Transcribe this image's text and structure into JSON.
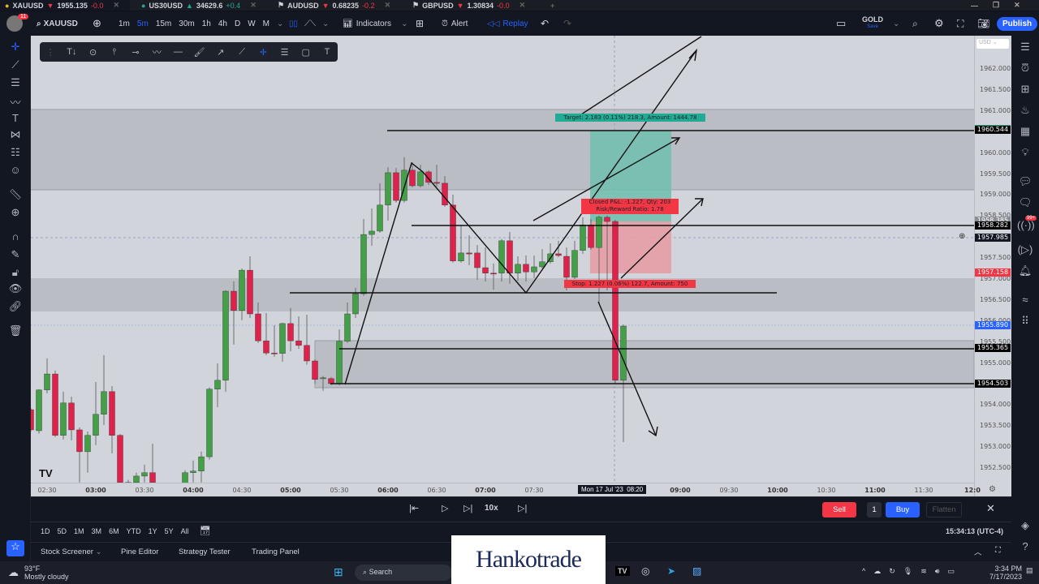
{
  "tabs": [
    {
      "symbol": "XAUUSD",
      "dir": "down",
      "price": "1955.135",
      "change": "-0.0"
    },
    {
      "symbol": "US30USD",
      "dir": "up",
      "price": "34629.6",
      "change": "+0.4"
    },
    {
      "symbol": "AUDUSD",
      "dir": "down",
      "price": "0.68235",
      "change": "-0.2"
    },
    {
      "symbol": "GBPUSD",
      "dir": "down",
      "price": "1.30834",
      "change": "-0.0"
    }
  ],
  "toolbar": {
    "notif_badge": "11",
    "symbol": "XAUUSD",
    "intervals": [
      "1m",
      "5m",
      "15m",
      "30m",
      "1h",
      "4h",
      "D",
      "W",
      "M"
    ],
    "active_interval": "5m",
    "indicators": "Indicators",
    "alert": "Alert",
    "replay": "Replay",
    "layout_name": "GOLD",
    "layout_status": "Save",
    "publish": "Publish"
  },
  "currency_select": "USD",
  "price_axis": {
    "labels": [
      "1962.000",
      "1961.500",
      "1961.000",
      "1960.500",
      "1960.000",
      "1959.500",
      "1959.000",
      "1958.500",
      "1958.000",
      "1957.500",
      "1957.000",
      "1956.500",
      "1956.000",
      "1955.500",
      "1955.000",
      "1954.500",
      "1954.000",
      "1953.500",
      "1953.000",
      "1952.500"
    ],
    "markers": [
      {
        "price": "1960.568",
        "color": "#22ab94"
      },
      {
        "price": "1960.544",
        "color": "#000000"
      },
      {
        "price": "1958.385",
        "color": "#8a8d94"
      },
      {
        "price": "1958.282",
        "color": "#000000"
      },
      {
        "price": "1957.985",
        "color": "#131722"
      },
      {
        "price": "1957.158",
        "color": "#f23645"
      },
      {
        "price": "1955.890",
        "color": "#2962ff"
      },
      {
        "price": "1955.365",
        "color": "#000000"
      },
      {
        "price": "1954.503",
        "color": "#000000"
      }
    ]
  },
  "time_axis": {
    "labels": [
      [
        "02:30",
        0
      ],
      [
        "03:00",
        1
      ],
      [
        "03:30",
        0
      ],
      [
        "04:00",
        1
      ],
      [
        "04:30",
        0
      ],
      [
        "05:00",
        1
      ],
      [
        "05:30",
        0
      ],
      [
        "06:00",
        1
      ],
      [
        "06:30",
        0
      ],
      [
        "07:00",
        1
      ],
      [
        "07:30",
        0
      ],
      [
        "09:00",
        1
      ],
      [
        "09:30",
        0
      ],
      [
        "10:00",
        1
      ],
      [
        "10:30",
        0
      ],
      [
        "11:00",
        1
      ],
      [
        "11:30",
        0
      ],
      [
        "12:0",
        1
      ]
    ],
    "crosshair": "Mon 17 Jul '23",
    "crosshair_time": "08:20"
  },
  "position": {
    "target": "Target: 2.183 (0.11%) 218.3, Amount: 1444.78",
    "closed_pnl": "Closed P&L: -1.227, Qty: 203",
    "rr": "Risk/Reward Ratio: 1.78",
    "stop": "Stop: 1.227 (0.06%) 122.7, Amount: 750"
  },
  "chart_data": {
    "type": "candlestick",
    "symbol": "XAUUSD",
    "interval": "5m",
    "ylim": [
      1952.3,
      1962.5
    ],
    "colors": {
      "up": "#43a047",
      "down": "#e0214b",
      "background": "#d1d4db",
      "zone": "#babdc3"
    },
    "candles_fields": [
      "time",
      "open",
      "high",
      "low",
      "close"
    ],
    "candles": [
      [
        "02:20",
        1953.89,
        1953.93,
        1953.37,
        1953.41
      ],
      [
        "02:25",
        1953.39,
        1954.38,
        1953.32,
        1954.36
      ],
      [
        "02:30",
        1954.36,
        1955.11,
        1954.28,
        1954.74
      ],
      [
        "02:35",
        1954.74,
        1954.82,
        1953.24,
        1953.28
      ],
      [
        "02:40",
        1953.28,
        1954.32,
        1953.18,
        1954.05
      ],
      [
        "02:45",
        1954.05,
        1954.2,
        1953.16,
        1953.41
      ],
      [
        "02:50",
        1953.41,
        1953.47,
        1952.16,
        1952.89
      ],
      [
        "02:55",
        1952.89,
        1953.37,
        1952.39,
        1953.28
      ],
      [
        "03:00",
        1953.28,
        1954.55,
        1953.05,
        1953.78
      ],
      [
        "03:05",
        1953.78,
        1955.19,
        1953.53,
        1954.32
      ],
      [
        "03:10",
        1954.32,
        1954.45,
        1952.85,
        1953.28
      ],
      [
        "03:15",
        1953.28,
        1953.31,
        1952.1,
        1952.16
      ],
      [
        "03:20",
        1952.16,
        1952.22,
        1951.48,
        1951.67
      ],
      [
        "03:25",
        1952.16,
        1952.39,
        1952.06,
        1952.31
      ],
      [
        "03:30",
        1952.31,
        1952.58,
        1952.16,
        1952.39
      ],
      [
        "03:35",
        1952.39,
        1953.08,
        1952.06,
        1952.16
      ],
      [
        "03:40",
        1952.1,
        1952.05,
        1951.7,
        1951.8
      ],
      [
        "03:45",
        1951.8,
        1951.95,
        1951.5,
        1951.6
      ],
      [
        "03:50",
        1951.6,
        1952.0,
        1951.5,
        1951.9
      ],
      [
        "03:55",
        1951.9,
        1952.45,
        1951.85,
        1952.39
      ],
      [
        "04:00",
        1952.39,
        1952.68,
        1952.16,
        1952.43
      ],
      [
        "04:05",
        1952.43,
        1952.89,
        1952.16,
        1952.77
      ],
      [
        "04:10",
        1952.77,
        1954.42,
        1952.7,
        1954.38
      ],
      [
        "04:15",
        1954.38,
        1954.99,
        1953.95,
        1954.59
      ],
      [
        "04:20",
        1954.59,
        1956.73,
        1954.32,
        1956.71
      ],
      [
        "04:25",
        1956.71,
        1956.94,
        1955.44,
        1956.25
      ],
      [
        "04:30",
        1956.25,
        1957.25,
        1956.02,
        1957.21
      ],
      [
        "04:35",
        1957.21,
        1957.54,
        1956.07,
        1956.17
      ],
      [
        "04:40",
        1956.17,
        1956.44,
        1955.48,
        1955.53
      ],
      [
        "04:45",
        1955.53,
        1956.19,
        1955.19,
        1955.24
      ],
      [
        "04:50",
        1955.24,
        1955.9,
        1955.15,
        1955.23
      ],
      [
        "04:55",
        1955.23,
        1955.96,
        1955.03,
        1955.94
      ],
      [
        "05:00",
        1955.94,
        1956.31,
        1955.28,
        1955.53
      ],
      [
        "05:05",
        1955.53,
        1956.11,
        1955.34,
        1955.42
      ],
      [
        "05:10",
        1955.42,
        1956.15,
        1954.96,
        1955.05
      ],
      [
        "05:15",
        1955.05,
        1955.09,
        1954.51,
        1954.61
      ],
      [
        "05:20",
        1954.63,
        1954.69,
        1954.34,
        1954.65
      ],
      [
        "05:25",
        1954.63,
        1954.67,
        1954.47,
        1954.51
      ],
      [
        "05:30",
        1954.51,
        1955.8,
        1954.47,
        1955.52
      ],
      [
        "05:35",
        1955.52,
        1956.44,
        1955.48,
        1956.17
      ],
      [
        "05:40",
        1956.17,
        1956.79,
        1956.07,
        1956.65
      ],
      [
        "05:45",
        1956.65,
        1958.43,
        1956.6,
        1958.06
      ],
      [
        "05:50",
        1958.06,
        1958.68,
        1957.79,
        1958.14
      ],
      [
        "05:55",
        1958.14,
        1959.28,
        1958.1,
        1958.76
      ],
      [
        "06:00",
        1958.76,
        1959.66,
        1958.39,
        1959.53
      ],
      [
        "06:05",
        1959.53,
        1959.64,
        1958.82,
        1958.87
      ],
      [
        "06:10",
        1958.87,
        1959.9,
        1958.82,
        1959.59
      ],
      [
        "06:15",
        1959.59,
        1959.78,
        1959.18,
        1959.22
      ],
      [
        "06:20",
        1959.22,
        1959.72,
        1959.18,
        1959.55
      ],
      [
        "06:25",
        1959.55,
        1959.59,
        1959.24,
        1959.3
      ],
      [
        "06:30",
        1959.3,
        1959.72,
        1959.2,
        1959.28
      ],
      [
        "06:35",
        1959.28,
        1959.45,
        1958.72,
        1958.76
      ],
      [
        "06:40",
        1958.76,
        1959.01,
        1957.39,
        1957.43
      ],
      [
        "06:45",
        1957.43,
        1958.27,
        1957.39,
        1957.62
      ],
      [
        "06:50",
        1957.62,
        1958.04,
        1957.33,
        1957.61
      ],
      [
        "06:55",
        1957.62,
        1957.81,
        1956.98,
        1957.27
      ],
      [
        "07:00",
        1957.27,
        1957.75,
        1956.94,
        1957.14
      ],
      [
        "07:05",
        1957.14,
        1957.37,
        1956.75,
        1957.13
      ],
      [
        "07:10",
        1957.14,
        1957.95,
        1956.94,
        1957.91
      ],
      [
        "07:15",
        1957.91,
        1958.12,
        1956.89,
        1957.14
      ],
      [
        "07:20",
        1957.14,
        1957.54,
        1956.96,
        1957.35
      ],
      [
        "07:25",
        1957.35,
        1957.56,
        1956.94,
        1957.17
      ],
      [
        "07:30",
        1957.17,
        1957.56,
        1957.02,
        1957.29
      ],
      [
        "07:35",
        1957.29,
        1957.71,
        1957.25,
        1957.41
      ],
      [
        "07:40",
        1957.41,
        1957.85,
        1957.37,
        1957.6
      ],
      [
        "07:45",
        1957.6,
        1957.91,
        1957.52,
        1957.56
      ],
      [
        "07:50",
        1957.54,
        1957.75,
        1956.73,
        1957.04
      ],
      [
        "07:55",
        1957.04,
        1957.91,
        1957.0,
        1957.68
      ],
      [
        "08:00",
        1957.68,
        1958.47,
        1957.6,
        1958.29
      ],
      [
        "08:05",
        1958.29,
        1958.43,
        1957.7,
        1957.75
      ],
      [
        "08:10",
        1957.75,
        1958.51,
        1956.44,
        1958.47
      ],
      [
        "08:15",
        1958.47,
        1958.51,
        1956.73,
        1958.37
      ],
      [
        "08:20",
        1958.37,
        1958.41,
        1954.53,
        1954.59
      ],
      [
        "08:25",
        1954.59,
        1955.92,
        1953.12,
        1955.88
      ]
    ]
  },
  "replay": {
    "speed": "10x",
    "sell": "Sell",
    "qty": "1",
    "buy": "Buy",
    "flatten": "Flatten"
  },
  "ranges": [
    "1D",
    "5D",
    "1M",
    "3M",
    "6M",
    "YTD",
    "1Y",
    "5Y",
    "All"
  ],
  "clock": "15:34:13 (UTC-4)",
  "panels": [
    "Stock Screener",
    "Pine Editor",
    "Strategy Tester",
    "Trading Panel"
  ],
  "logo": "Hankotrade",
  "taskbar": {
    "temp": "93°F",
    "weather": "Mostly cloudy",
    "search": "Search",
    "time": "3:34 PM",
    "date": "7/17/2023"
  },
  "badges": {
    "alerts": "99+"
  }
}
